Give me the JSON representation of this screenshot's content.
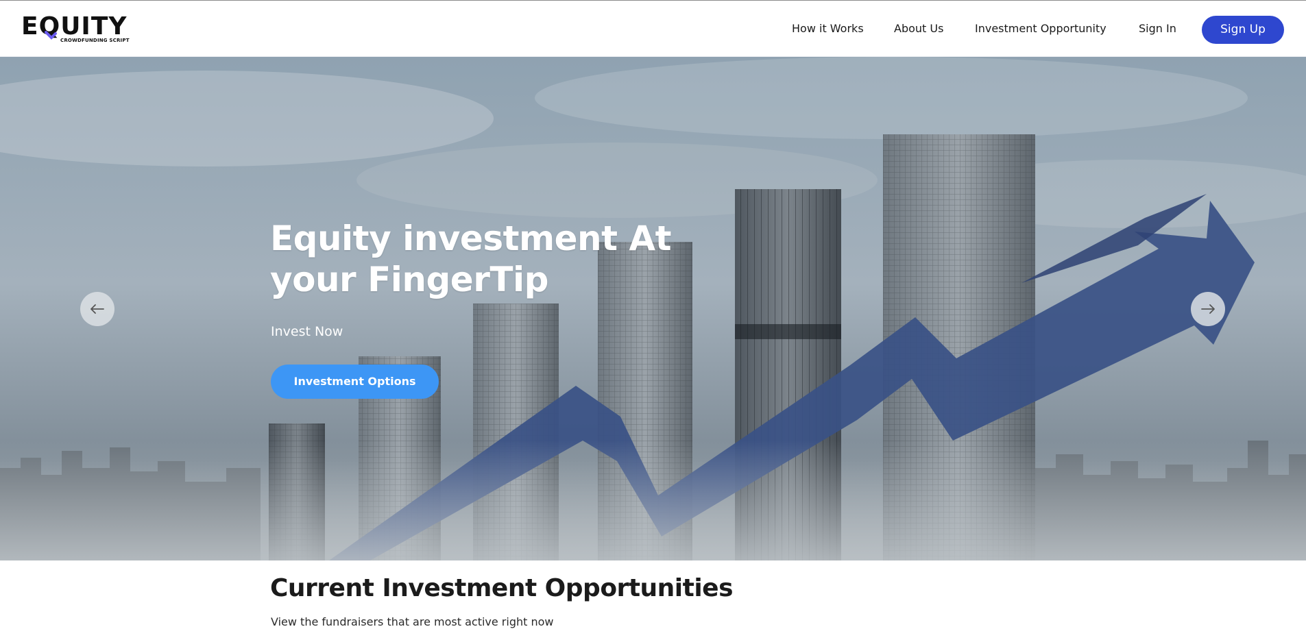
{
  "header": {
    "logo_text": "EQUITY",
    "logo_subtext": "CROWDFUNDING SCRIPT",
    "nav": [
      {
        "label": "How it Works"
      },
      {
        "label": "About Us"
      },
      {
        "label": "Investment Opportunity"
      },
      {
        "label": "Sign In"
      }
    ],
    "signup_label": "Sign Up"
  },
  "hero": {
    "title": "Equity investment At your FingerTip",
    "subtitle": "Invest Now",
    "cta_label": "Investment Options",
    "prev_icon": "arrow-left-icon",
    "next_icon": "arrow-right-icon"
  },
  "section": {
    "title": "Current Investment Opportunities",
    "subtitle": "View the fundraisers that are most active right now"
  },
  "colors": {
    "signup_bg": "#2e47cf",
    "cta_bg": "#3d96f5",
    "logo_accent": "#6b5cf0",
    "hero_arrow": "#3a5186"
  }
}
